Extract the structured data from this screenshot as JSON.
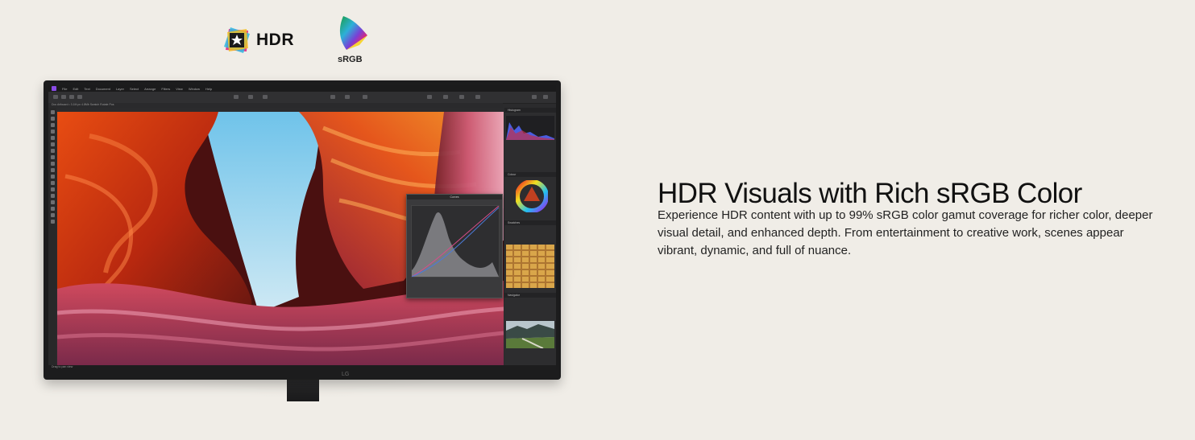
{
  "logos": {
    "hdr_label": "HDR",
    "srgb_label": "sRGB"
  },
  "monitor": {
    "brand": "LG",
    "app": {
      "menu": [
        "File",
        "Edit",
        "Text",
        "Document",
        "Layer",
        "Select",
        "Arrange",
        "Filters",
        "View",
        "Window",
        "Help"
      ],
      "context_bar": "Doc  Artboard  • 3.1M px  4.8Mb  Swatch  Rotate  Pos",
      "panel_titles": [
        "Histogram",
        "Colour",
        "Swatches",
        "Navigator"
      ],
      "curves_title": "Curves",
      "status_text": "Drag to pan view"
    }
  },
  "content": {
    "headline": "HDR Visuals with Rich sRGB Color",
    "body": "Experience HDR content with up to 99% sRGB color gamut coverage for richer color, deeper visual detail, and enhanced depth. From entertainment to creative work, scenes appear vibrant, dynamic, and full of nuance."
  },
  "colors": {
    "background": "#f0ede7",
    "headline": "#111111",
    "body": "#222222"
  }
}
